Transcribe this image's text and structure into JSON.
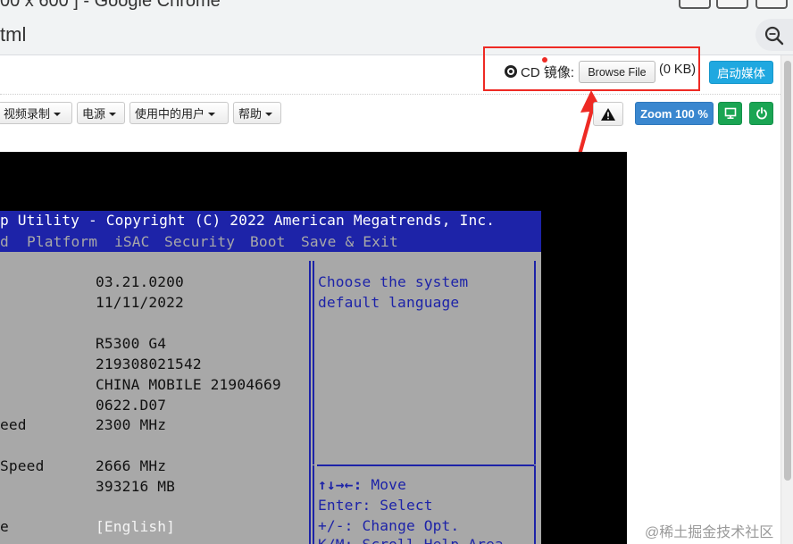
{
  "browser": {
    "window_title": "00 x 600 ] - Google Chrome",
    "url_fragment": "tml"
  },
  "toolbar_top": {
    "cd_label": "CD 镜像:",
    "browse_button": "Browse File",
    "file_size": "(0 KB)",
    "start_media_button": "启动媒体"
  },
  "toolbar_menus": {
    "items": [
      {
        "label": "视频录制"
      },
      {
        "label": "电源"
      },
      {
        "label": "使用中的用户"
      },
      {
        "label": "帮助"
      }
    ],
    "zoom_label": "Zoom 100 %"
  },
  "bios": {
    "title": "p Utility - Copyright (C) 2022 American Megatrends, Inc.",
    "menu": [
      "d",
      "Platform",
      "iSAC",
      "Security",
      "Boot",
      "Save & Exit"
    ],
    "rows": [
      {
        "label": "",
        "value": "03.21.0200"
      },
      {
        "label": "",
        "value": "11/11/2022"
      },
      {
        "label": "",
        "value": "R5300 G4"
      },
      {
        "label": "",
        "value": "219308021542"
      },
      {
        "label": "",
        "value": "CHINA MOBILE 21904669"
      },
      {
        "label": "",
        "value": "0622.D07"
      },
      {
        "label": "eed",
        "value": "2300 MHz"
      },
      {
        "label": "Speed",
        "value": "2666 MHz"
      },
      {
        "label": "",
        "value": "393216 MB"
      },
      {
        "label": "e",
        "value": "[English]"
      }
    ],
    "help_text": [
      "Choose the system",
      "default language"
    ],
    "keys": [
      {
        "key": "↑↓→←:",
        "action": "Move"
      },
      {
        "key": "Enter:",
        "action": "Select"
      },
      {
        "key": "+/-:",
        "action": "Change Opt."
      }
    ],
    "partial_line": "K/M: Scroll Help Area"
  },
  "watermark": "@稀土掘金技术社区",
  "colors": {
    "accent_blue": "#1fa8e0",
    "zoom_blue": "#3a87cf",
    "green": "#1aa553",
    "annotation_red": "#ee2a24",
    "bios_blue": "#1d23a8",
    "bios_gray": "#a8a8a8"
  }
}
